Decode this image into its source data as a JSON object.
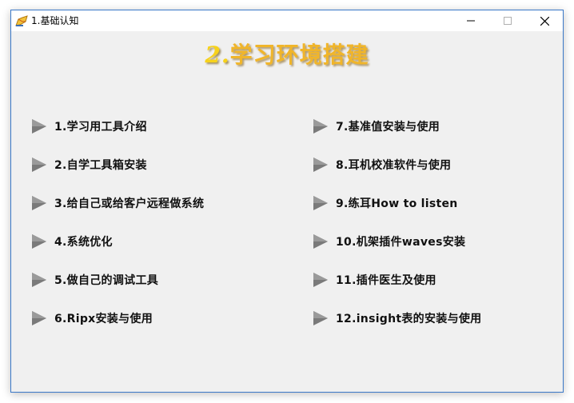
{
  "window": {
    "title": "1.基础认知"
  },
  "page": {
    "heading_num": "2.",
    "heading_text": "学习环境搭建"
  },
  "colors": {
    "heading": "#f0b52a",
    "border": "#3a78c8",
    "background": "#f0f0f0",
    "arrow": "#777777"
  },
  "menu": {
    "left": [
      {
        "label": "1.学习用工具介绍",
        "icon": "play-arrow-icon"
      },
      {
        "label": "2.自学工具箱安装",
        "icon": "play-arrow-icon"
      },
      {
        "label": "3.给自己或给客户远程做系统",
        "icon": "play-arrow-icon"
      },
      {
        "label": "4.系统优化",
        "icon": "play-arrow-icon"
      },
      {
        "label": "5.做自己的调试工具",
        "icon": "play-arrow-icon"
      },
      {
        "label": "6.Ripx安装与使用",
        "icon": "play-arrow-icon"
      }
    ],
    "right": [
      {
        "label": "7.基准值安装与使用",
        "icon": "play-arrow-icon"
      },
      {
        "label": "8.耳机校准软件与使用",
        "icon": "play-arrow-icon"
      },
      {
        "label": "9.练耳How to listen",
        "icon": "play-arrow-icon"
      },
      {
        "label": "10.机架插件waves安装",
        "icon": "play-arrow-icon"
      },
      {
        "label": "11.插件医生及使用",
        "icon": "play-arrow-icon"
      },
      {
        "label": "12.insight表的安装与使用",
        "icon": "play-arrow-icon"
      }
    ]
  }
}
